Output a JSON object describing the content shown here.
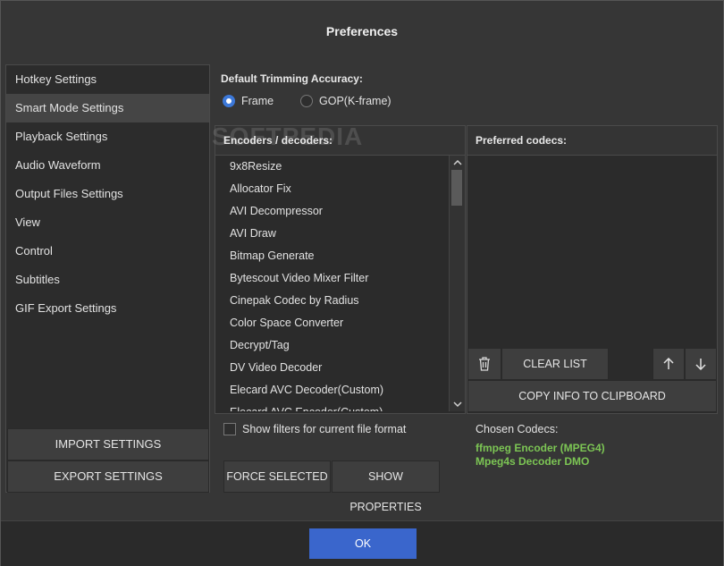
{
  "window": {
    "title": "Preferences"
  },
  "watermark": "SOFTPEDIA",
  "sidebar": {
    "items": [
      {
        "label": "Hotkey Settings"
      },
      {
        "label": "Smart Mode Settings"
      },
      {
        "label": "Playback Settings"
      },
      {
        "label": "Audio Waveform"
      },
      {
        "label": "Output Files Settings"
      },
      {
        "label": "View"
      },
      {
        "label": "Control"
      },
      {
        "label": "Subtitles"
      },
      {
        "label": "GIF Export Settings"
      }
    ],
    "active_index": 1,
    "import_label": "IMPORT SETTINGS",
    "export_label": "EXPORT SETTINGS"
  },
  "trimming": {
    "label": "Default Trimming Accuracy:",
    "options": [
      "Frame",
      "GOP(K-frame)"
    ],
    "selected": "Frame"
  },
  "encoders": {
    "header": "Encoders / decoders:",
    "items": [
      "9x8Resize",
      "Allocator Fix",
      "AVI Decompressor",
      "AVI Draw",
      "Bitmap Generate",
      "Bytescout Video Mixer Filter",
      "Cinepak Codec by Radius",
      "Color Space Converter",
      "Decrypt/Tag",
      "DV Video Decoder",
      "Elecard AVC Decoder(Custom)",
      "Elecard AVC Encoder(Custom)"
    ]
  },
  "preferred": {
    "header": "Preferred codecs:",
    "clear_label": "CLEAR LIST",
    "copy_label": "COPY INFO TO CLIPBOARD"
  },
  "filters": {
    "show_label": "Show filters for current file format",
    "checked": false
  },
  "actions": {
    "force_label": "FORCE SELECTED",
    "properties_label": "SHOW PROPERTIES"
  },
  "chosen": {
    "label": "Chosen Codecs:",
    "codecs": [
      "ffmpeg Encoder (MPEG4)",
      "Mpeg4s Decoder DMO"
    ]
  },
  "footer": {
    "ok_label": "OK"
  },
  "colors": {
    "accent": "#3c78d8",
    "ok": "#3a66cc",
    "codec_green": "#7cc554"
  }
}
